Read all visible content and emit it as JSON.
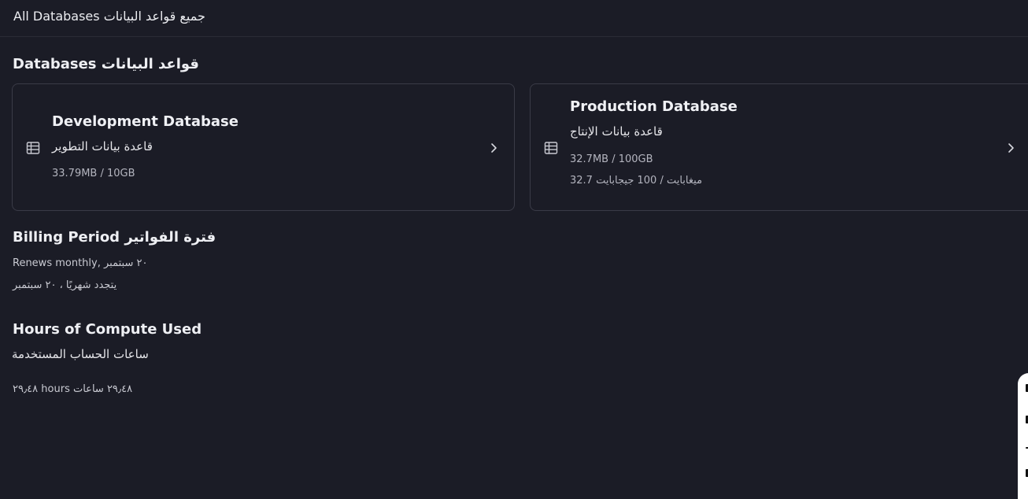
{
  "header": {
    "title": "All Databases جميع قواعد البيانات"
  },
  "databases": {
    "section_title": "Databases قواعد البيانات",
    "cards": [
      {
        "name": "Development Database",
        "name_ar": "قاعدة بيانات التطوير",
        "usage": "33.79MB / 10GB",
        "icon": "table-icon"
      },
      {
        "name": "Production Database",
        "name_ar": "قاعدة بيانات الإنتاج",
        "usage": "32.7MB / 100GB",
        "usage_ar": "32.7 ميغابايت / 100 جيجابايت",
        "icon": "table-icon"
      }
    ]
  },
  "billing": {
    "title": "Billing Period فترة الفواتير",
    "renews": "Renews monthly, ٢٠ سبتمبر",
    "renews_ar": "يتجدد شهريًا ، ٢٠ سبتمبر"
  },
  "compute": {
    "title": "Hours of Compute Used",
    "title_ar": "ساعات الحساب المستخدمة",
    "hours": "٢٩٫٤٨ hours ٢٩٫٤٨ ساعات"
  },
  "colors": {
    "background": "#1b1c26",
    "card_border": "#3a3b47",
    "text": "#e6e6ea"
  }
}
